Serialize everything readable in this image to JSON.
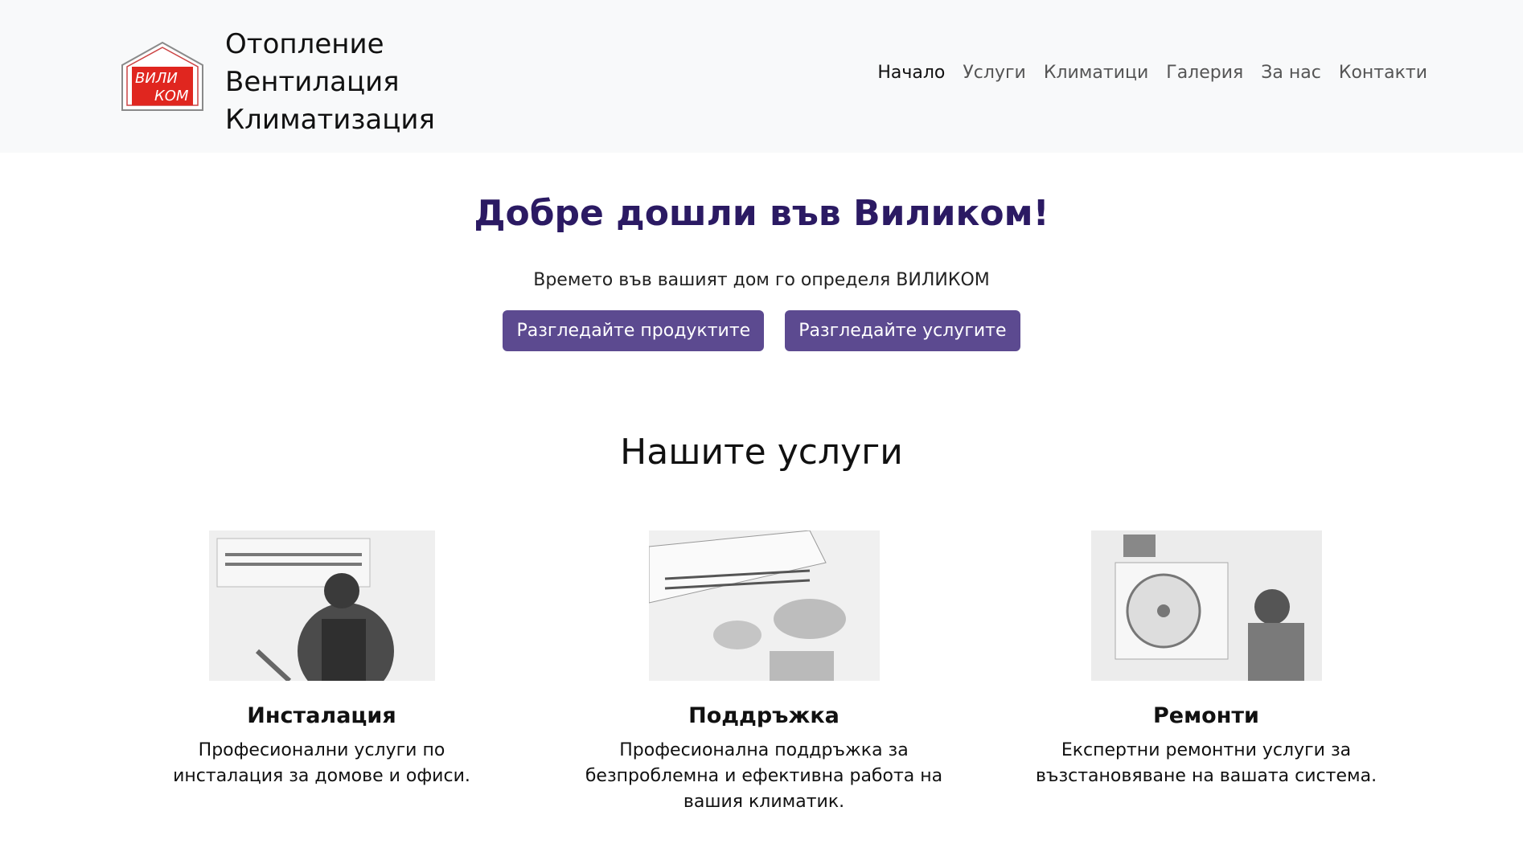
{
  "header": {
    "logo_text_top": "ВИЛИ",
    "logo_text_bottom": "КОМ",
    "brand_lines": [
      "Отопление",
      "Вентилация",
      "Климатизация"
    ],
    "nav": [
      {
        "label": "Начало",
        "active": true
      },
      {
        "label": "Услуги",
        "active": false
      },
      {
        "label": "Климатици",
        "active": false
      },
      {
        "label": "Галерия",
        "active": false
      },
      {
        "label": "За нас",
        "active": false
      },
      {
        "label": "Контакти",
        "active": false
      }
    ]
  },
  "hero": {
    "title": "Добре дошли във Виликом!",
    "subtitle": "Времето във вашият дом го определя ВИЛИКОМ",
    "buttons": [
      "Разгледайте продуктите",
      "Разгледайте услугите"
    ]
  },
  "services": {
    "title": "Нашите услуги",
    "items": [
      {
        "title": "Инсталация",
        "desc": "Професионални услуги по инсталация за домове и офиси."
      },
      {
        "title": "Поддръжка",
        "desc": "Професионална поддръжка за безпроблемна и ефективна работа на вашия климатик."
      },
      {
        "title": "Ремонти",
        "desc": "Експертни ремонтни услуги за възстановяване на вашата система."
      }
    ]
  },
  "colors": {
    "header_bg": "#f8f9fa",
    "accent": "#5c4a90",
    "title": "#2b1a63",
    "logo_red": "#e0261f"
  }
}
